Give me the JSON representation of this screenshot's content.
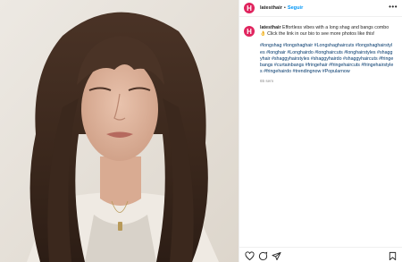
{
  "post": {
    "username": "latesthair",
    "separator": "•",
    "follow_label": "Seguir",
    "avatar_letter": "H",
    "more_label": "•••",
    "caption_username": "latesthair",
    "caption_text": "Effortless vibes with a long shag and bangs combo 👌 Click the link in our bio to see more photos like this!",
    "hashtags": "#longshag #longshaghair #Longshaghaircuts #longshaghairstyles #longhair #Longhairdo #longhaircuts #longhairstyles #shaggyhair #shaggyhairstyles #shaggyhairdo #shaggyhaircuts #fringebangs #curtainbangs #fringehair #fringehaircuts #fringehairstyles #fringehairdo #trendingnow #Popularnow",
    "time_ago": "65 sem"
  },
  "icons": {
    "like": "heart-icon",
    "comment": "comment-icon",
    "share": "share-icon",
    "save": "bookmark-icon",
    "options": "more-icon"
  },
  "colors": {
    "brand": "#e0245e",
    "link": "#0095f6",
    "hashtag": "#00376b"
  }
}
